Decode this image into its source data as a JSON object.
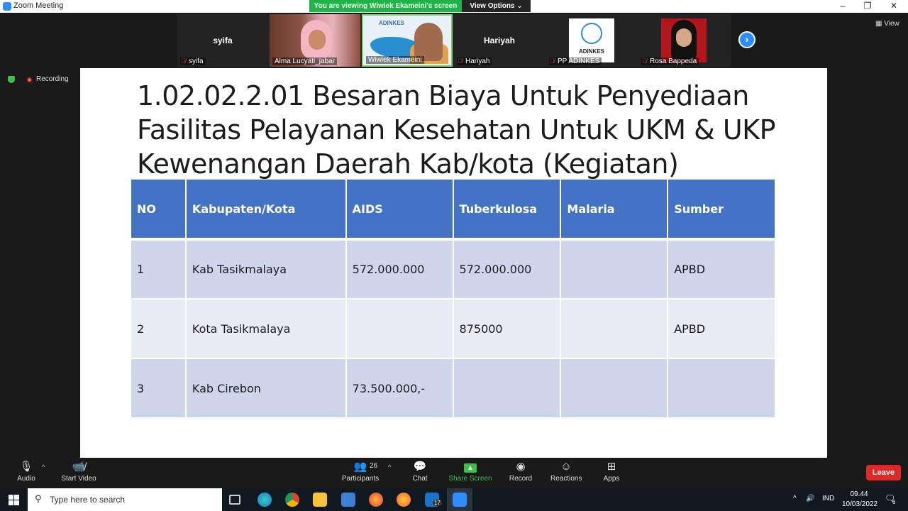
{
  "window": {
    "title": "Zoom Meeting",
    "share_banner": "You are viewing Wiwiek Ekameini's screen",
    "view_options": "View Options ⌄",
    "controls": {
      "minimize": "–",
      "restore": "❐",
      "close": "✕"
    }
  },
  "participants_strip": [
    {
      "name": "syifa",
      "center_label": "syifa",
      "muted": true,
      "type": "name-only"
    },
    {
      "name": "Alma Lucyati_jabar",
      "muted": false,
      "type": "video"
    },
    {
      "name": "Wiwiek Ekameini",
      "muted": false,
      "type": "video",
      "active": true
    },
    {
      "name": "Hariyah",
      "center_label": "Hariyah",
      "muted": true,
      "type": "name-only"
    },
    {
      "name": "PP ADINKES",
      "muted": true,
      "type": "logo"
    },
    {
      "name": "Rosa Bappeda",
      "muted": true,
      "type": "photo"
    }
  ],
  "strip_logo_text": "ADINKES",
  "wiwiek_logo_text": "ADINKES",
  "view_label": "View",
  "recording_label": "Recording",
  "slide": {
    "title": "1.02.02.2.01 Besaran Biaya Untuk Penyediaan Fasilitas Pelayanan Kesehatan Untuk UKM & UKP Kewenangan Daerah Kab/kota (Kegiatan)",
    "table": {
      "headers": [
        "NO",
        "Kabupaten/Kota",
        "AIDS",
        "Tuberkulosa",
        "Malaria",
        "Sumber"
      ],
      "rows": [
        [
          "1",
          "Kab Tasikmalaya",
          "572.000.000",
          "572.000.000",
          "",
          "APBD"
        ],
        [
          "2",
          "Kota Tasikmalaya",
          "",
          "875000",
          "",
          "APBD"
        ],
        [
          "3",
          "Kab Cirebon",
          "73.500.000,-",
          "",
          "",
          ""
        ]
      ]
    }
  },
  "toolbar": {
    "audio": "Audio",
    "start_video": "Start Video",
    "participants": "Participants",
    "participants_count": "26",
    "chat": "Chat",
    "share_screen": "Share Screen",
    "record": "Record",
    "reactions": "Reactions",
    "apps": "Apps",
    "leave": "Leave"
  },
  "taskbar": {
    "search_placeholder": "Type here to search",
    "mail_badge": "17",
    "language": "IND",
    "time": "09.44",
    "date": "10/03/2022",
    "notification_count": "6"
  },
  "colors": {
    "zoom_blue": "#2d8cff",
    "banner_green": "#21b24a",
    "table_header": "#4472c4",
    "row_odd": "#cfd5ea",
    "row_even": "#e9ebf5",
    "leave_red": "#e02828"
  }
}
